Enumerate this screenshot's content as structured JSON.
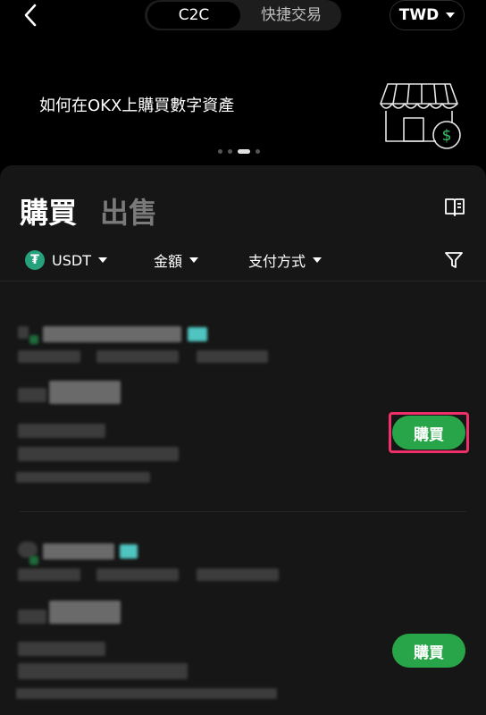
{
  "header": {
    "back_icon": "chevron-left-icon",
    "segments": [
      {
        "label": "C2C",
        "active": true
      },
      {
        "label": "快捷交易",
        "active": false
      }
    ],
    "currency": "TWD"
  },
  "banner": {
    "text": "如何在OKX上購買數字資產",
    "illustration": "storefront-dollar-icon",
    "dots_count": 4,
    "active_dot": 2
  },
  "trade_tabs": {
    "buy": "購買",
    "sell": "出售"
  },
  "filters": {
    "coin": "USDT",
    "amount": "金額",
    "payment": "支付方式"
  },
  "listings": [
    {
      "action": "購買"
    },
    {
      "action": "購買"
    }
  ],
  "colors": {
    "buy_button": "#27a548",
    "highlight": "#f0306a",
    "panel_bg": "#161616"
  }
}
